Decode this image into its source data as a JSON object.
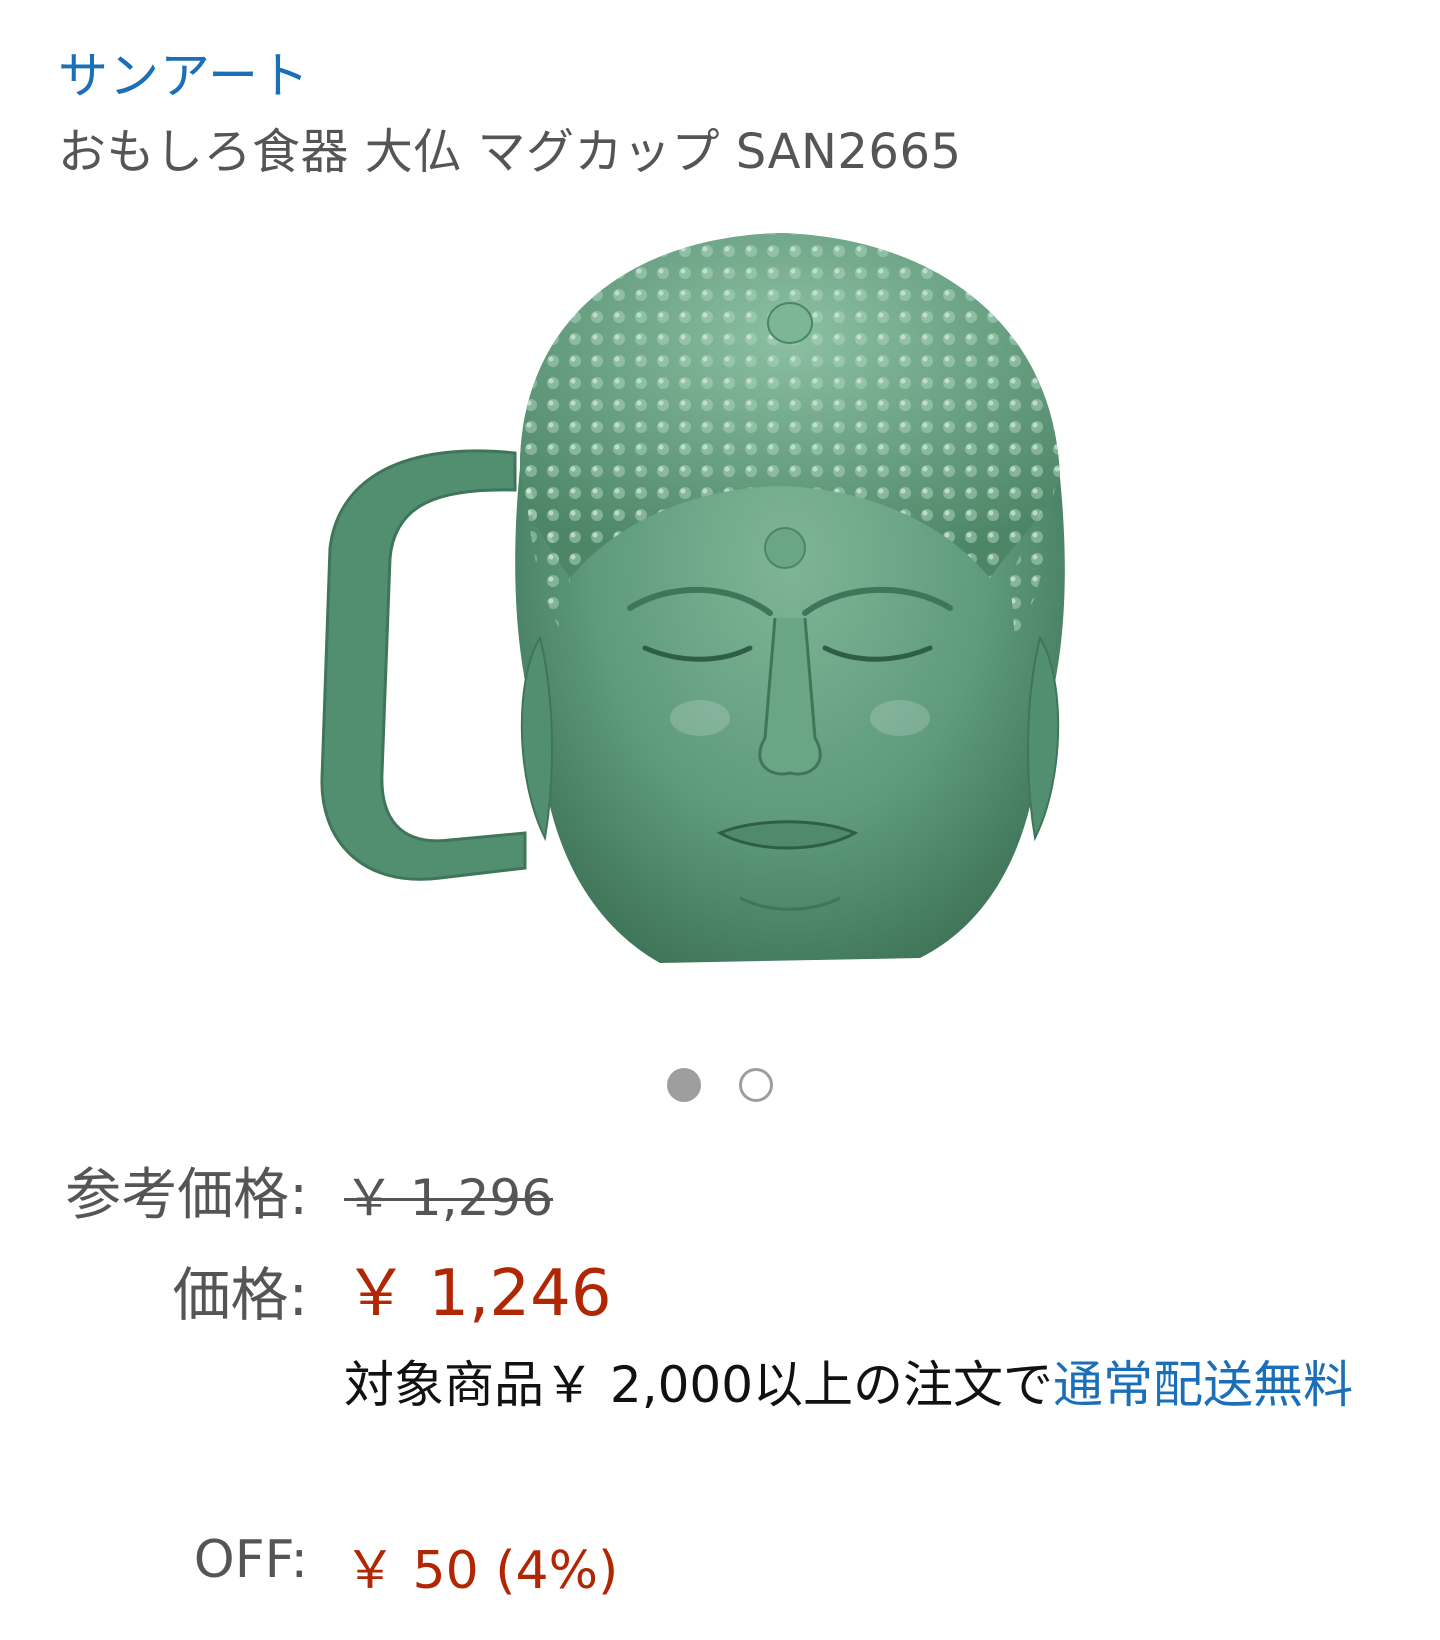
{
  "brand": "サンアート",
  "product_title": "おもしろ食器 大仏 マグカップ SAN2665",
  "image": {
    "alt": "buddha-head-mug",
    "color": "#5f9a7c"
  },
  "carousel": {
    "total": 2,
    "active_index": 0
  },
  "pricing": {
    "reference_label": "参考価格:",
    "reference_price": "￥ 1,296",
    "price_label": "価格:",
    "price": "￥ 1,246",
    "shipping_text": "対象商品￥ 2,000以上の注文で",
    "shipping_link": "通常配送無料",
    "off_label": "OFF:",
    "off_value": "￥ 50 (4%)"
  },
  "colors": {
    "link": "#1a6fb8",
    "price": "#b12704",
    "muted": "#555555"
  }
}
